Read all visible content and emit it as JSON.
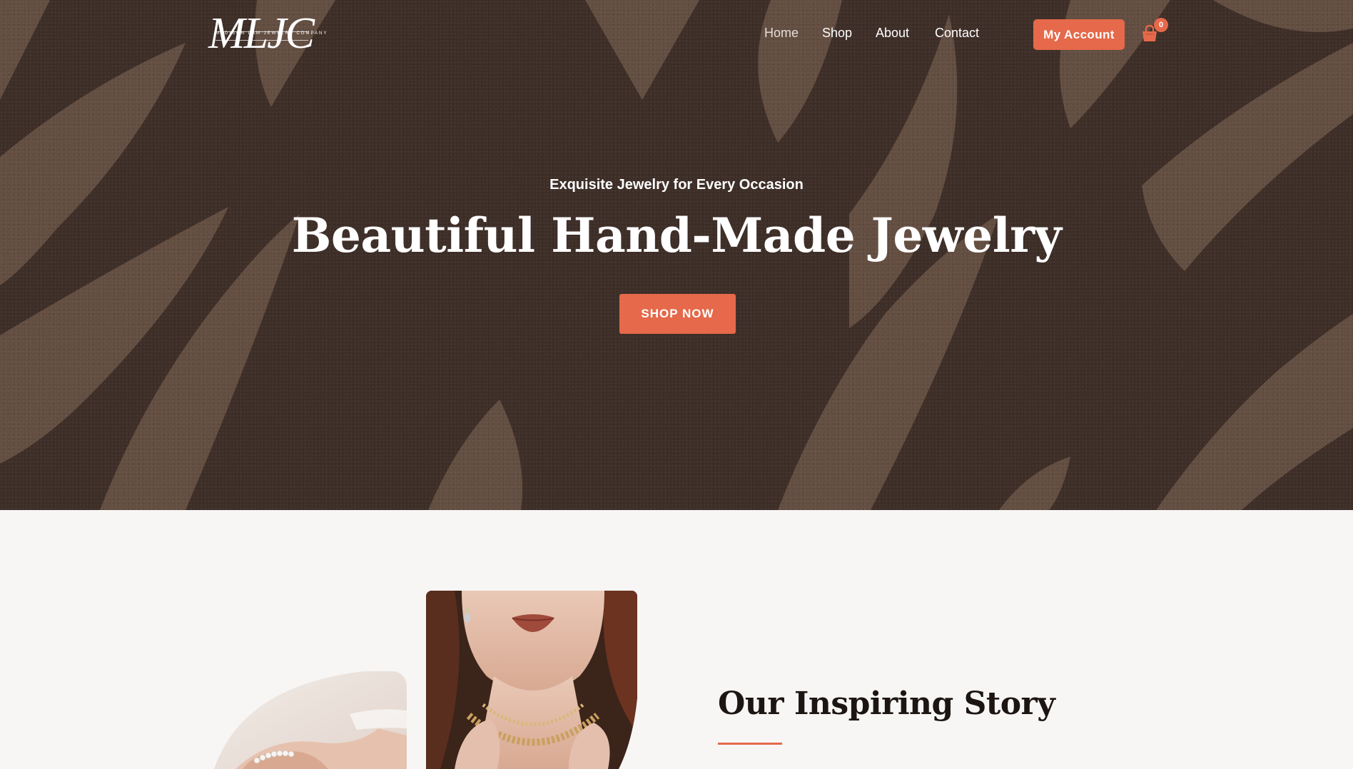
{
  "brand": {
    "logo_text": "MLJC",
    "logo_tagline": "MADISON LAM JEWELRY COMPANY"
  },
  "nav": {
    "items": [
      {
        "label": "Home",
        "active": true
      },
      {
        "label": "Shop",
        "active": false
      },
      {
        "label": "About",
        "active": false
      },
      {
        "label": "Contact",
        "active": false
      }
    ]
  },
  "header": {
    "account_label": "My Account",
    "cart_count": "0",
    "cart_icon": "shopping-bag-icon"
  },
  "hero": {
    "subtitle": "Exquisite Jewelry for Every Occasion",
    "title": "Beautiful Hand-Made Jewelry",
    "cta_label": "SHOP NOW"
  },
  "story": {
    "title": "Our Inspiring Story"
  },
  "colors": {
    "accent": "#e5694a",
    "hero_dark": "#3e2e28",
    "hero_light": "#6a5446",
    "page_bg": "#f7f6f5",
    "heading": "#1d1512"
  }
}
